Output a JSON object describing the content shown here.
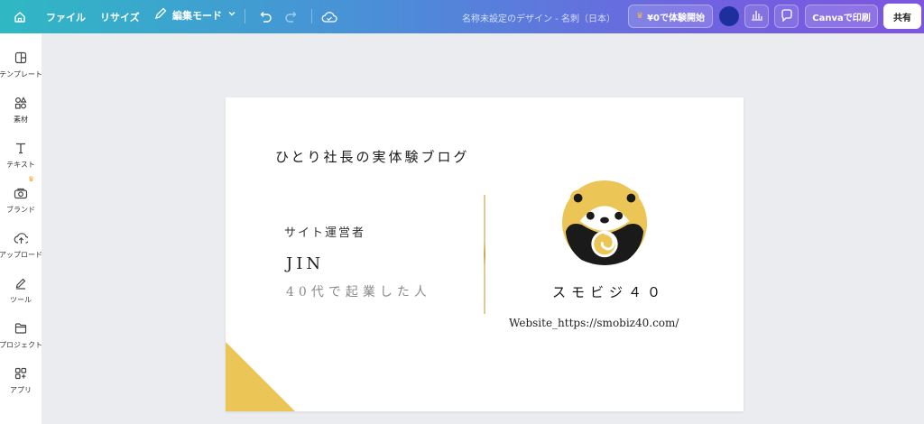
{
  "topbar": {
    "file_label": "ファイル",
    "resize_label": "リサイズ",
    "edit_mode_label": "編集モード",
    "doc_title": "名称未設定のデザイン - 名刺（日本）",
    "trial_label": "¥0で体験開始",
    "print_label": "Canvaで印刷",
    "share_label": "共有"
  },
  "sidebar": {
    "items": [
      {
        "label": "テンプレート",
        "icon": "template-icon"
      },
      {
        "label": "素材",
        "icon": "elements-icon"
      },
      {
        "label": "テキスト",
        "icon": "text-icon"
      },
      {
        "label": "ブランド",
        "icon": "brand-icon"
      },
      {
        "label": "アップロード",
        "icon": "upload-icon"
      },
      {
        "label": "ツール",
        "icon": "tools-icon"
      },
      {
        "label": "プロジェクト",
        "icon": "folder-icon"
      },
      {
        "label": "アプリ",
        "icon": "apps-icon"
      }
    ]
  },
  "card": {
    "blog_title": "ひとり社長の実体験ブログ",
    "operator_label": "サイト運営者",
    "name": "JIN",
    "tagline": "40代で起業した人",
    "brand": "スモビジ４０",
    "website": "Website_https://smobiz40.com/"
  },
  "colors": {
    "accent_gold": "#ecc557",
    "avatar_blue": "#1c2f9c",
    "canvas_bg": "#ebecf0"
  }
}
